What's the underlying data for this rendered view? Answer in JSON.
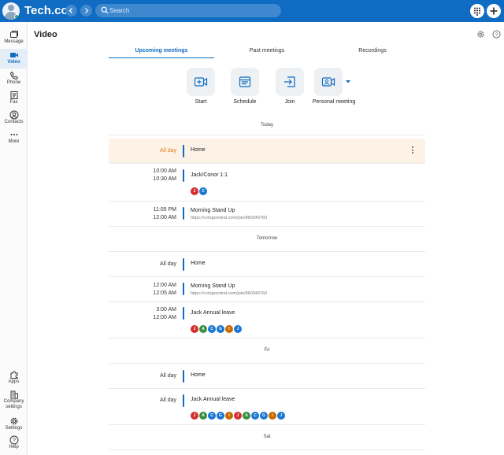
{
  "header": {
    "brand": "Tech.co",
    "search": {
      "placeholder": "Search"
    }
  },
  "nav": {
    "items": [
      {
        "label": "Message",
        "icon": "message-icon"
      },
      {
        "label": "Video",
        "icon": "video-icon",
        "active": true
      },
      {
        "label": "Phone",
        "icon": "phone-icon"
      },
      {
        "label": "Fax",
        "icon": "fax-icon"
      },
      {
        "label": "Contacts",
        "icon": "contacts-icon"
      },
      {
        "label": "More",
        "icon": "more-icon"
      }
    ],
    "bottom": [
      {
        "label": "Apps",
        "icon": "puzzle-icon"
      },
      {
        "label": "Company settings",
        "icon": "building-icon"
      },
      {
        "label": "Settings",
        "icon": "gear-icon"
      },
      {
        "label": "Help",
        "icon": "help-icon"
      }
    ]
  },
  "page": {
    "title": "Video"
  },
  "tabs": [
    "Upcoming meetings",
    "Past meetings",
    "Recordings"
  ],
  "actions": [
    {
      "label": "Start",
      "icon": "start-video-icon"
    },
    {
      "label": "Schedule",
      "icon": "schedule-icon"
    },
    {
      "label": "Join",
      "icon": "join-icon"
    },
    {
      "label": "Personal meeting",
      "icon": "personal-meeting-icon"
    }
  ],
  "sections": [
    {
      "label": "Today",
      "events": [
        {
          "start": "All day",
          "end": "",
          "title": "Home",
          "link": "",
          "participants": [],
          "highlighted": true
        },
        {
          "start": "10:00 AM",
          "end": "10:30 AM",
          "title": "Jack/Conor 1:1",
          "link": "",
          "participants": [
            "J",
            "C"
          ]
        },
        {
          "start": "11:05 PM",
          "end": "12:00 AM",
          "title": "Morning Stand Up",
          "link": "https://v.ringcentral.com/join/960340760",
          "participants": []
        }
      ]
    },
    {
      "label": "Tomorrow",
      "events": [
        {
          "start": "All day",
          "end": "",
          "title": "Home",
          "link": "",
          "participants": []
        },
        {
          "start": "12:00 AM",
          "end": "12:05 AM",
          "title": "Morning Stand Up",
          "link": "https://v.ringcentral.com/join/960340760",
          "participants": []
        },
        {
          "start": "3:00 AM",
          "end": "12:00 AM",
          "title": "Jack Annual leave",
          "link": "",
          "participants": [
            "J",
            "A",
            "C",
            "G",
            "I",
            "J"
          ]
        }
      ]
    },
    {
      "label": "Fri",
      "events": [
        {
          "start": "All day",
          "end": "",
          "title": "Home",
          "link": "",
          "participants": []
        },
        {
          "start": "All day",
          "end": "",
          "title": "Jack Annual leave",
          "link": "",
          "participants": [
            "J",
            "A",
            "C",
            "G",
            "I",
            "J",
            "A",
            "C",
            "G",
            "I",
            "J"
          ]
        }
      ]
    },
    {
      "label": "Sat",
      "events": []
    }
  ],
  "colors": {
    "brand_blue": "#0f6cc2",
    "highlight_bg": "#fdf2e6",
    "allday_orange": "#e07d10",
    "chip_J": "#d32f2f",
    "chip_A": "#388e3c",
    "chip_C": "#1976d2",
    "chip_G": "#1976d2",
    "chip_I": "#c66a00"
  }
}
